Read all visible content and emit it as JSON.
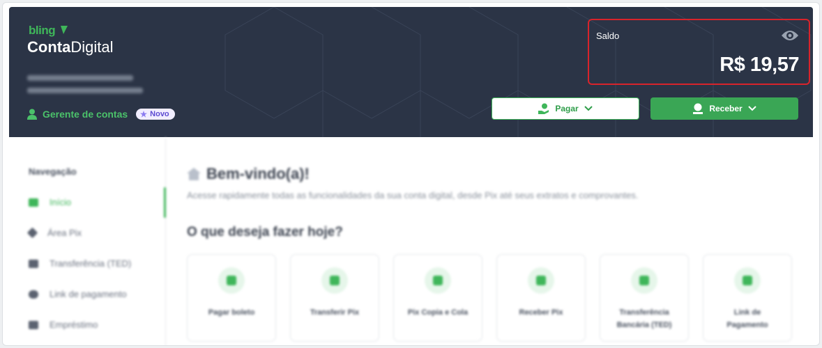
{
  "header": {
    "logo_small": "bling",
    "logo_bold": "Conta",
    "logo_light": "Digital",
    "manager_label": "Gerente de contas",
    "manager_badge": "Novo"
  },
  "saldo": {
    "label": "Saldo",
    "value": "R$ 19,57",
    "eye_icon": "eye-icon"
  },
  "actions": {
    "pagar_label": "Pagar",
    "receber_label": "Receber"
  },
  "sidebar": {
    "title": "Navegação",
    "items": [
      {
        "label": "Início",
        "icon": "home-icon",
        "active": true
      },
      {
        "label": "Área Pix",
        "icon": "pix-icon",
        "active": false
      },
      {
        "label": "Transferência (TED)",
        "icon": "bank-icon",
        "active": false
      },
      {
        "label": "Link de pagamento",
        "icon": "link-icon",
        "active": false
      },
      {
        "label": "Empréstimo",
        "icon": "loan-icon",
        "active": false
      }
    ]
  },
  "main": {
    "welcome": "Bem-vindo(a)!",
    "subtitle": "Acesse rapidamente todas as funcionalidades da sua conta digital, desde Pix até seus extratos e comprovantes.",
    "question": "O que deseja fazer hoje?",
    "cards": [
      {
        "line1": "Pagar boleto",
        "line2": ""
      },
      {
        "line1": "Transferir Pix",
        "line2": ""
      },
      {
        "line1": "Pix Copia e Cola",
        "line2": ""
      },
      {
        "line1": "Receber Pix",
        "line2": ""
      },
      {
        "line1": "Transferência",
        "line2": "Bancária (TED)"
      },
      {
        "line1": "Link de",
        "line2": "Pagamento"
      }
    ]
  },
  "colors": {
    "header_bg": "#2b3446",
    "brand_green": "#3fb65a",
    "highlight_red": "#d9232b"
  }
}
